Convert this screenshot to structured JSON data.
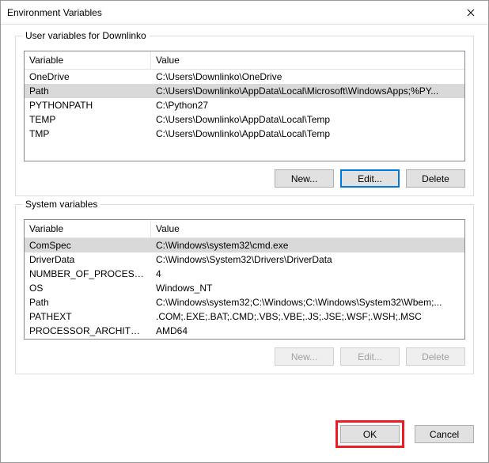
{
  "title": "Environment Variables",
  "userVars": {
    "label": "User variables for Downlinko",
    "headers": {
      "variable": "Variable",
      "value": "Value"
    },
    "rows": [
      {
        "name": "OneDrive",
        "value": "C:\\Users\\Downlinko\\OneDrive"
      },
      {
        "name": "Path",
        "value": "C:\\Users\\Downlinko\\AppData\\Local\\Microsoft\\WindowsApps;%PY..."
      },
      {
        "name": "PYTHONPATH",
        "value": "C:\\Python27"
      },
      {
        "name": "TEMP",
        "value": "C:\\Users\\Downlinko\\AppData\\Local\\Temp"
      },
      {
        "name": "TMP",
        "value": "C:\\Users\\Downlinko\\AppData\\Local\\Temp"
      }
    ],
    "buttons": {
      "new": "New...",
      "edit": "Edit...",
      "delete": "Delete"
    }
  },
  "sysVars": {
    "label": "System variables",
    "headers": {
      "variable": "Variable",
      "value": "Value"
    },
    "rows": [
      {
        "name": "ComSpec",
        "value": "C:\\Windows\\system32\\cmd.exe"
      },
      {
        "name": "DriverData",
        "value": "C:\\Windows\\System32\\Drivers\\DriverData"
      },
      {
        "name": "NUMBER_OF_PROCESSORS",
        "value": "4"
      },
      {
        "name": "OS",
        "value": "Windows_NT"
      },
      {
        "name": "Path",
        "value": "C:\\Windows\\system32;C:\\Windows;C:\\Windows\\System32\\Wbem;..."
      },
      {
        "name": "PATHEXT",
        "value": ".COM;.EXE;.BAT;.CMD;.VBS;.VBE;.JS;.JSE;.WSF;.WSH;.MSC"
      },
      {
        "name": "PROCESSOR_ARCHITECTURE",
        "value": "AMD64"
      }
    ],
    "buttons": {
      "new": "New...",
      "edit": "Edit...",
      "delete": "Delete"
    }
  },
  "footer": {
    "ok": "OK",
    "cancel": "Cancel"
  }
}
